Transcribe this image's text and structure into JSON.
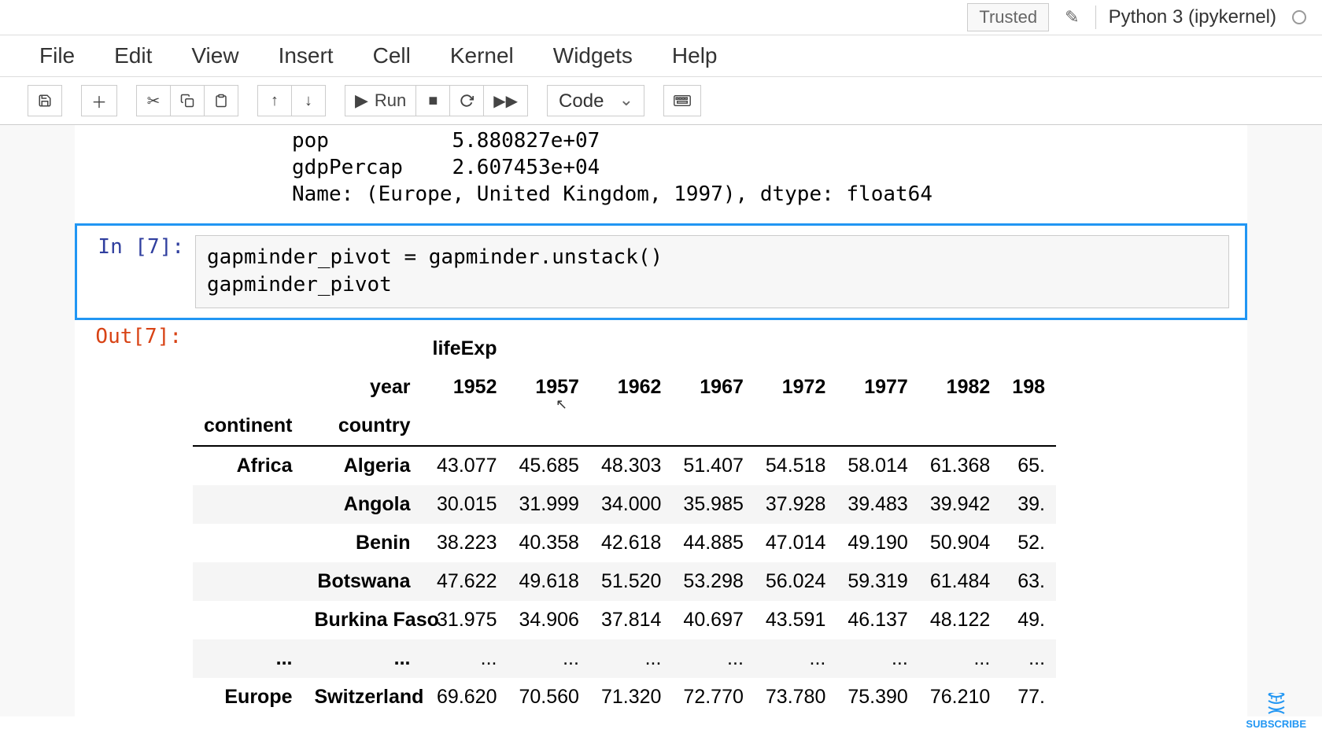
{
  "header": {
    "trusted": "Trusted",
    "kernelName": "Python 3 (ipykernel)"
  },
  "menu": {
    "file": "File",
    "edit": "Edit",
    "view": "View",
    "insert": "Insert",
    "cell": "Cell",
    "kernel": "Kernel",
    "widgets": "Widgets",
    "help": "Help"
  },
  "toolbar": {
    "runLabel": "Run",
    "cellType": "Code"
  },
  "prevOutput": "pop          5.880827e+07\ngdpPercap    2.607453e+04\nName: (Europe, United Kingdom, 1997), dtype: float64",
  "cell7": {
    "inPrompt": "In [7]:",
    "outPrompt": "Out[7]:",
    "code": "gapminder_pivot = gapminder.unstack()\ngapminder_pivot"
  },
  "table": {
    "topHeader": "lifeExp",
    "yearLabel": "year",
    "continentLabel": "continent",
    "countryLabel": "country",
    "years": [
      "1952",
      "1957",
      "1962",
      "1967",
      "1972",
      "1977",
      "1982",
      "198"
    ],
    "rows": [
      {
        "continent": "Africa",
        "country": "Algeria",
        "vals": [
          "43.077",
          "45.685",
          "48.303",
          "51.407",
          "54.518",
          "58.014",
          "61.368",
          "65."
        ]
      },
      {
        "continent": "",
        "country": "Angola",
        "vals": [
          "30.015",
          "31.999",
          "34.000",
          "35.985",
          "37.928",
          "39.483",
          "39.942",
          "39."
        ]
      },
      {
        "continent": "",
        "country": "Benin",
        "vals": [
          "38.223",
          "40.358",
          "42.618",
          "44.885",
          "47.014",
          "49.190",
          "50.904",
          "52."
        ]
      },
      {
        "continent": "",
        "country": "Botswana",
        "vals": [
          "47.622",
          "49.618",
          "51.520",
          "53.298",
          "56.024",
          "59.319",
          "61.484",
          "63."
        ]
      },
      {
        "continent": "",
        "country": "Burkina Faso",
        "vals": [
          "31.975",
          "34.906",
          "37.814",
          "40.697",
          "43.591",
          "46.137",
          "48.122",
          "49."
        ]
      },
      {
        "continent": "...",
        "country": "...",
        "vals": [
          "...",
          "...",
          "...",
          "...",
          "...",
          "...",
          "...",
          "..."
        ]
      },
      {
        "continent": "Europe",
        "country": "Switzerland",
        "vals": [
          "69.620",
          "70.560",
          "71.320",
          "72.770",
          "73.780",
          "75.390",
          "76.210",
          "77."
        ]
      }
    ]
  },
  "subscribe": "SUBSCRIBE"
}
